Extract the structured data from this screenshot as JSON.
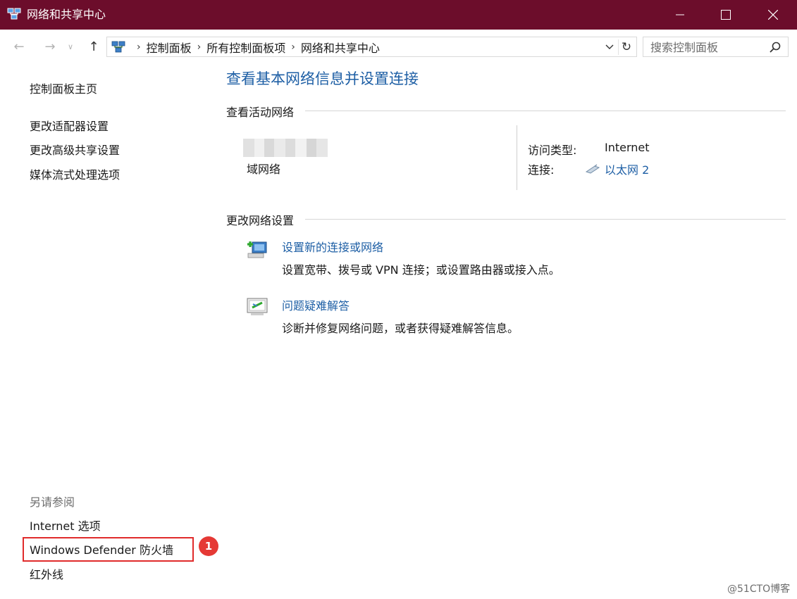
{
  "window": {
    "title": "网络和共享中心",
    "titlebar_color": "#6c0d2b"
  },
  "nav": {
    "breadcrumbs": [
      "控制面板",
      "所有控制面板项",
      "网络和共享中心"
    ],
    "search_placeholder": "搜索控制面板"
  },
  "sidebar": {
    "home_link": "控制面板主页",
    "links": [
      "更改适配器设置",
      "更改高级共享设置",
      "媒体流式处理选项"
    ],
    "see_also_label": "另请参阅",
    "see_also_links": [
      "Internet 选项",
      "Windows Defender 防火墙",
      "红外线"
    ],
    "highlight_badge": "1"
  },
  "main": {
    "title": "查看基本网络信息并设置连接",
    "active_networks_heading": "查看活动网络",
    "network": {
      "type": "域网络",
      "access_type_label": "访问类型:",
      "access_type_value": "Internet",
      "connection_label": "连接:",
      "connection_value": "以太网 2"
    },
    "change_settings_heading": "更改网络设置",
    "tasks": [
      {
        "title": "设置新的连接或网络",
        "desc": "设置宽带、拨号或 VPN 连接；或设置路由器或接入点。",
        "icon": "new-connection-icon"
      },
      {
        "title": "问题疑难解答",
        "desc": "诊断并修复网络问题，或者获得疑难解答信息。",
        "icon": "troubleshoot-icon"
      }
    ]
  },
  "watermark": "@51CTO博客",
  "colors": {
    "link": "#1e5fa5",
    "highlight": "#e02b2b",
    "badge": "#e53935"
  }
}
